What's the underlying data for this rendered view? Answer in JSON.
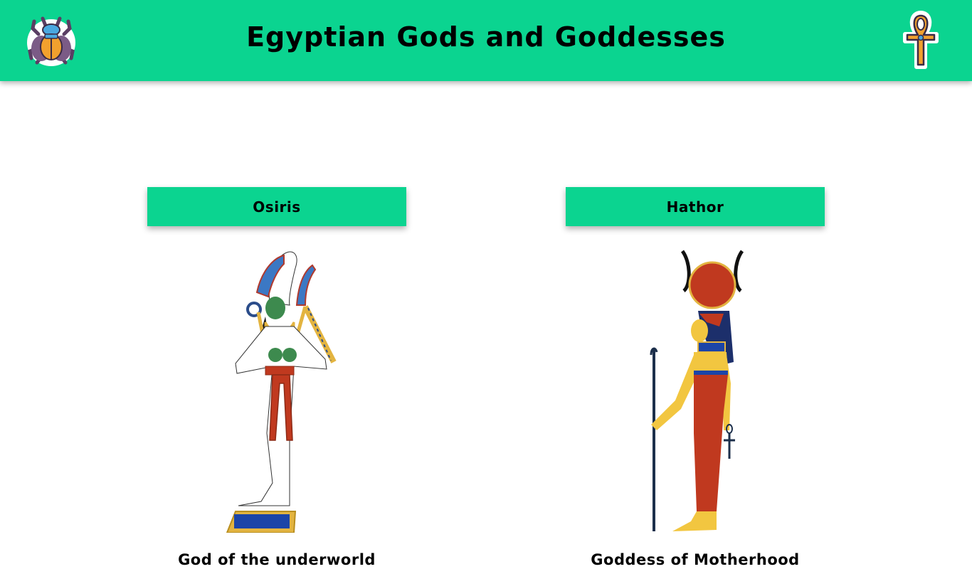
{
  "header": {
    "title": "Egyptian Gods and Goddesses",
    "left_icon": "scarab-icon",
    "right_icon": "ankh-icon",
    "bg_color": "#0bd490"
  },
  "gods": [
    {
      "name": "Osiris",
      "description": "God of the underworld",
      "icon": "osiris-figure"
    },
    {
      "name": "Hathor",
      "description": "Goddess of Motherhood",
      "icon": "hathor-figure"
    }
  ]
}
